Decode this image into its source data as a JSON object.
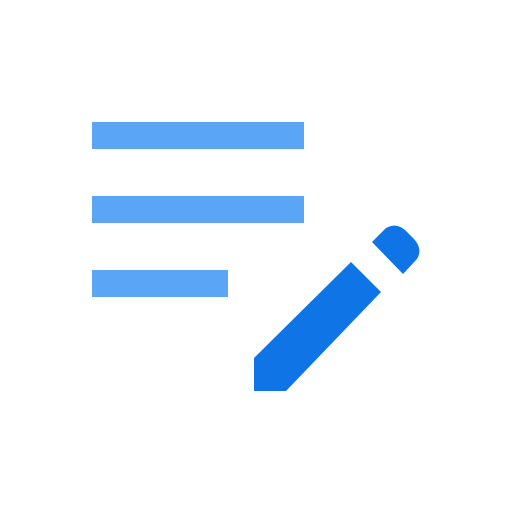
{
  "icon": {
    "name": "edit-note-icon",
    "colors": {
      "background": "#ffffff",
      "lines": "#5aa5f5",
      "pencil": "#0f74e6"
    },
    "parts": [
      {
        "name": "text-line-1-icon"
      },
      {
        "name": "text-line-2-icon"
      },
      {
        "name": "text-line-3-icon"
      },
      {
        "name": "pencil-icon"
      }
    ]
  }
}
